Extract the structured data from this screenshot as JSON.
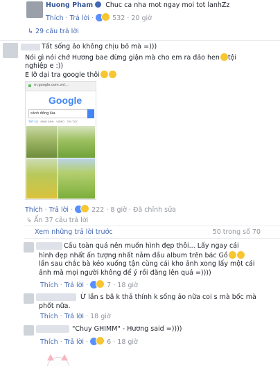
{
  "top_comment": {
    "name": "Huong Pham",
    "text": "Chuc ca nha mot ngay moi tot lanhZz",
    "like": "Thích",
    "reply": "Trả lời",
    "reactions": "532",
    "time": "20 giờ"
  },
  "replies_count": "29 câu trả lời",
  "second_comment": {
    "line1": "Tất sống ảo không chịu bỏ mà =)))",
    "line2": "Nói gì nói chớ Hương bae đừng giận mà cho em ra đảo hen",
    "line2b": "tội",
    "line3": "nghiệp e :))",
    "line4": "E lỡ dại tra google thôi",
    "like": "Thích",
    "reply": "Trả lời",
    "reactions": "222",
    "time": "8 giờ",
    "edited": "Đã chỉnh sửa"
  },
  "screenshot": {
    "url": "m.google.com.vn/...",
    "search_query": "cánh đồng lúa",
    "tabs": [
      "TẤT CẢ",
      "HÌNH ẢNH",
      "VIDEO",
      "TIN TỨC"
    ],
    "logo": "Google"
  },
  "hide_replies": "Ẩn 37 câu trả lời",
  "view_previous": "Xem những trả lời trước",
  "pagination": "50 trong số 70",
  "reply1": {
    "line1": "Cầu toàn quá nên muốn hình đẹp thôi... Lấy ngay cái",
    "line2": "hình đẹp nhất ấn tượng nhất nằm đầu album trên bác Gồ",
    "line3": "lần sau chắc bà kéo xuống tận cùng cái kho ảnh xong lấy một cái",
    "line4": "ảnh mà mọi người không để ý rồi đăng lên quá =))))",
    "like": "Thích",
    "reply": "Trả lời",
    "reactions": "7",
    "time": "18 giờ"
  },
  "reply2": {
    "line1": "Ừ lần s bã k thả thính k sống ảo nữa coi s mà bốc mà",
    "line2": "phốt nữa.",
    "like": "Thích",
    "reply": "Trả lời",
    "time": "18 giờ"
  },
  "reply3": {
    "text": "\"Chuy GHIMM\" - Hương said =))))",
    "like": "Thích",
    "reply": "Trả lời",
    "reactions": "6",
    "time": "18 giờ"
  }
}
